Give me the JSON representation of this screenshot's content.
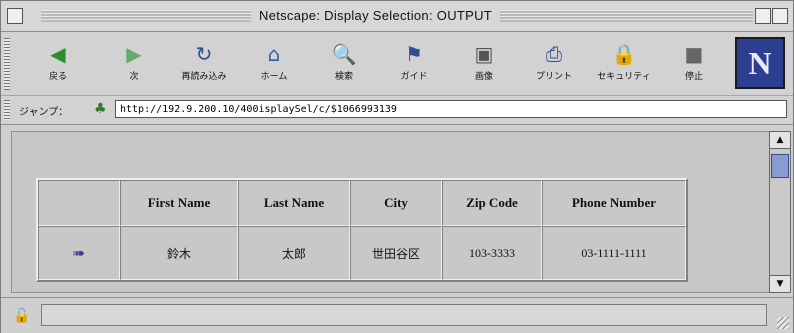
{
  "window": {
    "title": "Netscape: Display Selection: OUTPUT"
  },
  "toolbar": {
    "buttons": [
      {
        "label": "戻る",
        "icon": "back-arrow-icon"
      },
      {
        "label": "次",
        "icon": "forward-arrow-icon"
      },
      {
        "label": "再読み込み",
        "icon": "reload-icon"
      },
      {
        "label": "ホーム",
        "icon": "home-icon"
      },
      {
        "label": "検索",
        "icon": "search-icon"
      },
      {
        "label": "ガイド",
        "icon": "guide-icon"
      },
      {
        "label": "画像",
        "icon": "images-icon"
      },
      {
        "label": "プリント",
        "icon": "print-icon"
      },
      {
        "label": "セキュリティ",
        "icon": "security-lock-icon"
      },
      {
        "label": "停止",
        "icon": "stop-icon"
      }
    ],
    "logo": "N"
  },
  "location": {
    "label": "ジャンプ：",
    "url": "http://192.9.200.10/400isplaySel/c/$1066993139"
  },
  "table": {
    "headers": [
      "",
      "First Name",
      "Last Name",
      "City",
      "Zip Code",
      "Phone Number"
    ],
    "rows": [
      {
        "icon": "edit-record-icon",
        "first_name": "鈴木",
        "last_name": "太郎",
        "city": "世田谷区",
        "zip": "103-3333",
        "phone": "03-1111-1111"
      }
    ]
  },
  "colors": {
    "logo_bg": "#2b3e8f",
    "chrome": "#d2d2d2",
    "content_bg": "#c8c8c8"
  }
}
